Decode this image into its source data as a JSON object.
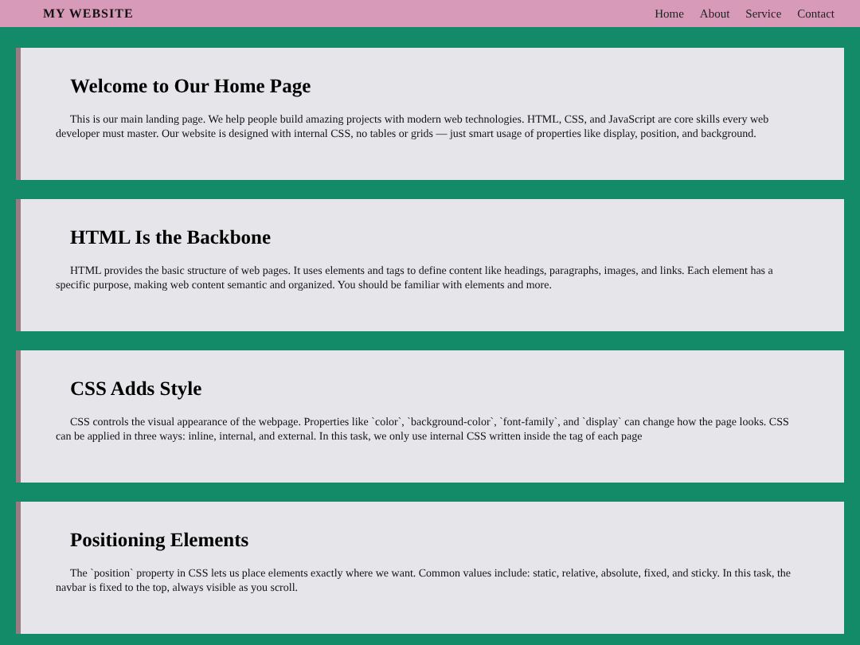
{
  "navbar": {
    "brand": "MY WEBSITE",
    "links": [
      "Home",
      "About",
      "Service",
      "Contact"
    ]
  },
  "sections": [
    {
      "title": "Welcome to Our Home Page",
      "text": "This is our main landing page. We help people build amazing projects with modern web technologies. HTML, CSS, and JavaScript are core skills every web developer must master. Our website is designed with internal CSS, no tables or grids — just smart usage of properties like display, position, and background."
    },
    {
      "title": "HTML Is the Backbone",
      "text": "HTML provides the basic structure of web pages. It uses elements and tags to define content like headings, paragraphs, images, and links. Each element has a specific purpose, making web content semantic and organized. You should be familiar with elements and more."
    },
    {
      "title": "CSS Adds Style",
      "text": "CSS controls the visual appearance of the webpage. Properties like `color`, `background-color`, `font-family`, and `display` can change how the page looks. CSS can be applied in three ways: inline, internal, and external. In this task, we only use internal CSS written inside the tag of each page"
    },
    {
      "title": "Positioning Elements",
      "text": "The `position` property in CSS lets us place elements exactly where we want. Common values include: static, relative, absolute, fixed, and sticky. In this task, the navbar is fixed to the top, always visible as you scroll."
    }
  ]
}
